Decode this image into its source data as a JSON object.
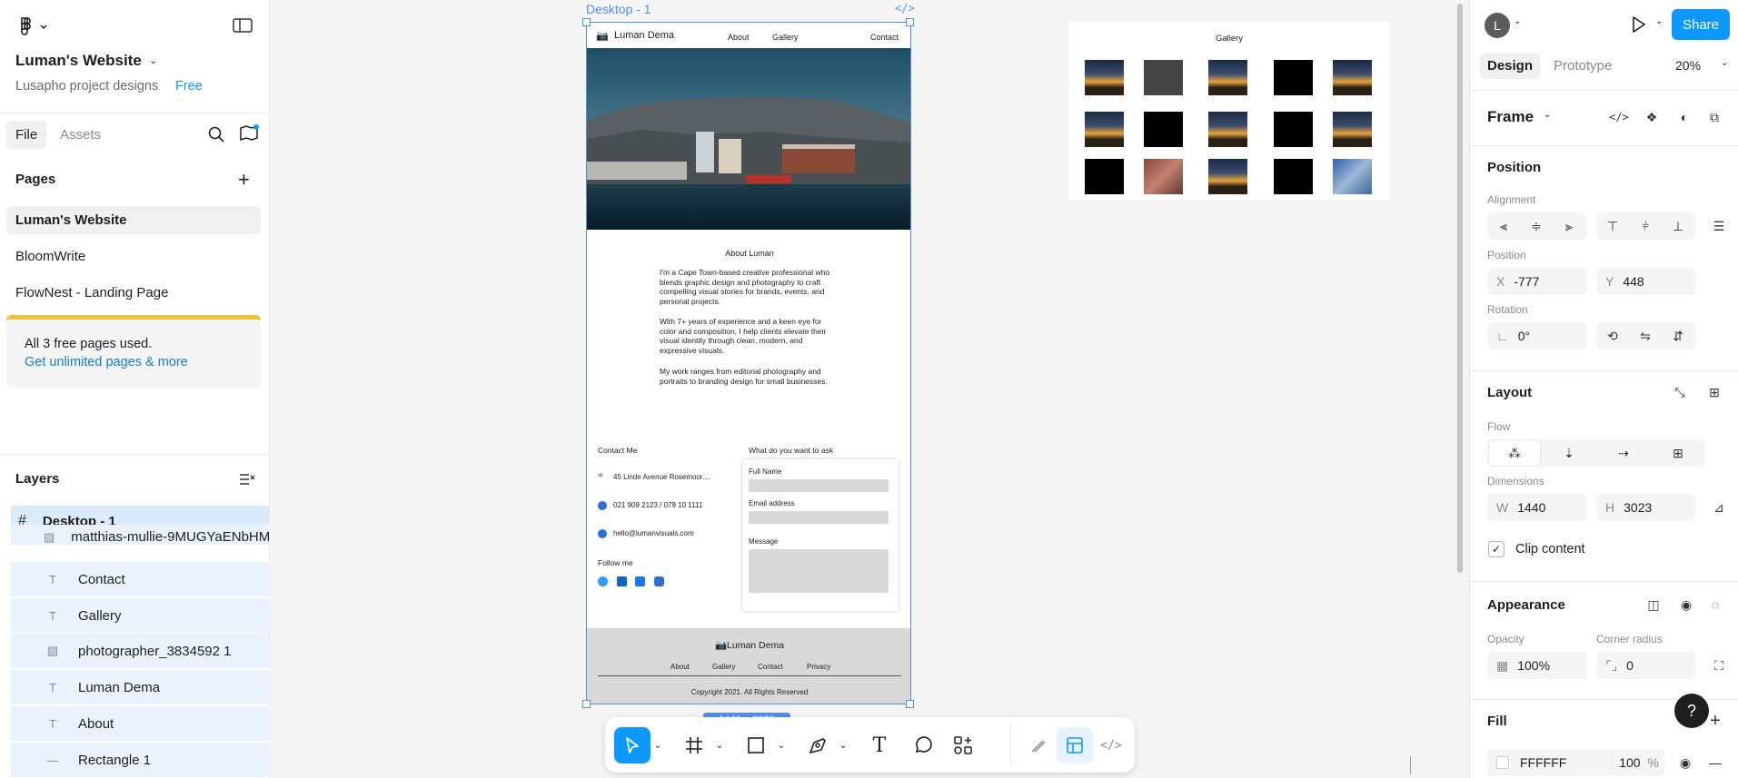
{
  "app": {
    "file_name": "Luman's Website",
    "project": "Lusapho project designs",
    "plan_badge": "Free"
  },
  "left_tabs": [
    "File",
    "Assets"
  ],
  "pages": {
    "title": "Pages",
    "items": [
      "Luman's Website",
      "BloomWrite",
      "FlowNest - Landing Page"
    ],
    "limit_notice": "All 3 free pages used.",
    "upgrade_link": "Get unlimited pages & more"
  },
  "layers": {
    "title": "Layers",
    "root": "Desktop - 1",
    "items": [
      {
        "name": "matthias-mullie-9MUGYaENbHM-",
        "type": "image"
      },
      {
        "name": "Contact",
        "type": "text"
      },
      {
        "name": "Gallery",
        "type": "text"
      },
      {
        "name": "photographer_3834592 1",
        "type": "image"
      },
      {
        "name": "Luman Dema",
        "type": "text"
      },
      {
        "name": "About",
        "type": "text"
      },
      {
        "name": "Rectangle 1",
        "type": "line"
      }
    ]
  },
  "canvas": {
    "frame_label": "Desktop - 1",
    "size_badge": "1440 × 3023",
    "site": {
      "brand": "Luman Dema",
      "nav": [
        "About",
        "Gallery",
        "Contact"
      ],
      "about_title": "About Luman",
      "about_p1": "I'm a Cape Town-based creative professional who blends graphic design and photography to craft compelling visual stories for brands, events, and personal projects.",
      "about_p2": "With 7+ years of experience and a keen eye for color and composition, I help clients elevate their visual identity through clean, modern, and expressive visuals.",
      "about_p3": "My work ranges from editorial photography and portraits to branding design for small businesses.",
      "contact_title": "Contact Me",
      "address": "45 Linde Avenue Rosemoor....",
      "phone": "021 909 2123 /  079 10 1111",
      "email": "hello@lumanvisuals.com",
      "follow": "Follow me",
      "form_title": "What do you want to ask",
      "form_name": "Full Name",
      "form_email": "Email address",
      "form_message": "Message",
      "footer_brand": "Luman Dema",
      "footer_links": [
        "About",
        "Gallery",
        "Contact",
        "Privacy"
      ],
      "copyright": "Copyright 2021. All Rights Reserved"
    },
    "gallery_title": "Gallery"
  },
  "right": {
    "avatar": "L",
    "share": "Share",
    "tabs": [
      "Design",
      "Prototype"
    ],
    "zoom": "20%",
    "frame_type": "Frame",
    "position_title": "Position",
    "alignment_label": "Alignment",
    "position_label": "Position",
    "x_key": "X",
    "x": "-777",
    "y_key": "Y",
    "y": "448",
    "rotation_label": "Rotation",
    "rotation": "0°",
    "layout_title": "Layout",
    "flow_label": "Flow",
    "dimensions_label": "Dimensions",
    "w_key": "W",
    "w": "1440",
    "h_key": "H",
    "h": "3023",
    "clip": "Clip content",
    "appearance_title": "Appearance",
    "opacity_label": "Opacity",
    "opacity": "100%",
    "radius_label": "Corner radius",
    "radius": "0",
    "fill_title": "Fill",
    "fill_hex": "FFFFFF",
    "fill_opacity": "100",
    "fill_pct": "%"
  },
  "colors": {
    "accent": "#0d99ff",
    "selection": "#4f8ff2",
    "notice": "#f5c12e"
  }
}
